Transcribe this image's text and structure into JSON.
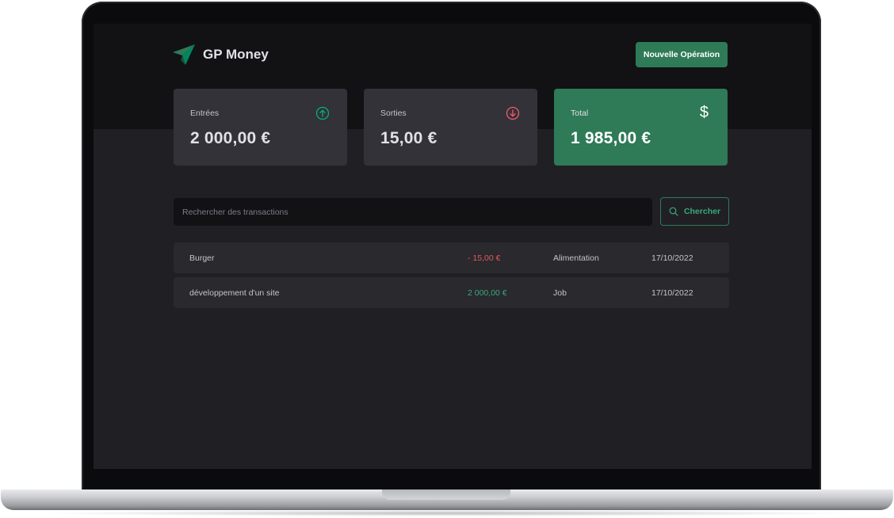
{
  "app": {
    "title": "GP Money",
    "new_operation_label": "Nouvelle Opération"
  },
  "summary": {
    "income": {
      "label": "Entrées",
      "value": "2 000,00 €",
      "icon": "arrow-circle-up-icon",
      "color": "#00b37e"
    },
    "outcome": {
      "label": "Sorties",
      "value": "15,00 €",
      "icon": "arrow-circle-down-icon",
      "color": "#f75a68"
    },
    "total": {
      "label": "Total",
      "value": "1 985,00 €",
      "icon": "$"
    }
  },
  "search": {
    "placeholder": "Rechercher des transactions",
    "button_label": "Chercher"
  },
  "transactions": [
    {
      "description": "Burger",
      "amount": "- 15,00 €",
      "category": "Alimentation",
      "date": "17/10/2022",
      "type": "outcome"
    },
    {
      "description": "développement d'un site",
      "amount": "2 000,00 €",
      "category": "Job",
      "date": "17/10/2022",
      "type": "income"
    }
  ],
  "colors": {
    "brand": "#2f7a57",
    "background": "#202024",
    "header": "#121214",
    "card": "#323238",
    "row": "#29292e"
  }
}
